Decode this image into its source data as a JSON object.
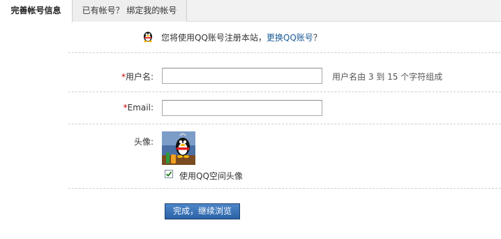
{
  "tabs": {
    "complete_info": "完善帐号信息",
    "bind_existing": "已有帐号？ 绑定我的帐号"
  },
  "notice": {
    "text": "您将使用QQ账号注册本站，",
    "link": "更换QQ账号",
    "suffix": "？"
  },
  "form": {
    "required_mark": "*",
    "username_label": "用户名:",
    "username_value": "",
    "username_hint": "用户名由 3 到 15 个字符组成",
    "email_label": "Email:",
    "email_value": "",
    "avatar_label": "头像:",
    "use_qzone_avatar_label": "使用QQ空间头像",
    "use_qzone_avatar_checked": true,
    "submit_label": "完成，继续浏览"
  },
  "icons": {
    "qq": "qq-penguin-icon",
    "check": "check-icon"
  },
  "colors": {
    "link": "#1a5a96",
    "required": "#d00000",
    "button": "#2b62a6"
  }
}
